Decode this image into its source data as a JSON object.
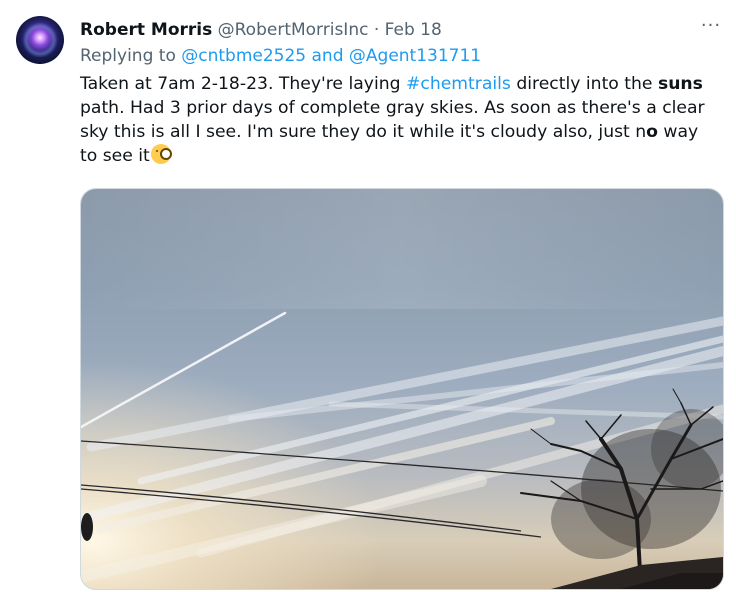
{
  "tweet": {
    "author_name": "Robert Morris",
    "author_handle": "@RobertMorrisInc",
    "separator": "·",
    "date": "Feb 18",
    "more_label": "···",
    "replying_prefix": "Replying to",
    "replying_to": "@cntbme2525 and @Agent131711",
    "text_part1": "Taken at 7am 2-18-23. They're laying ",
    "hashtag": "#chemtrails",
    "text_part2": " directly into the ",
    "bold_word": "suns",
    "text_part3": " path. Had 3 prior days of complete gray skies. As soon as there's a clear sky this is all I see. I'm sure they do it while it's cloudy also, just n",
    "bold_o": "o",
    "text_part4": " way to see it",
    "emoji": "face-with-monocle-emoji"
  },
  "colors": {
    "link": "#1d9bf0",
    "secondary_text": "#536471",
    "primary_text": "#0f1419"
  },
  "media": {
    "description_icon": "sky-photo-image"
  }
}
